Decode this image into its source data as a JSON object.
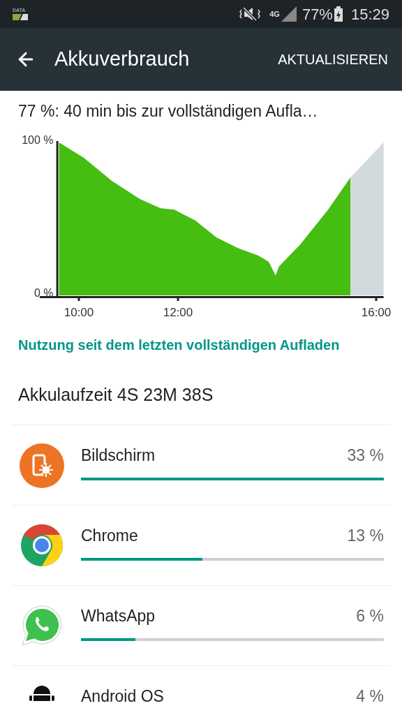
{
  "status_bar": {
    "data_label": "DATA",
    "network": "4G",
    "battery": "77%",
    "time": "15:29"
  },
  "app_bar": {
    "title": "Akkuverbrauch",
    "action": "AKTUALISIEREN"
  },
  "summary": "77 %: 40 min bis zur vollständigen Aufla…",
  "chart_data": {
    "type": "area",
    "xlim": [
      9.21,
      16.15
    ],
    "ylim": [
      0,
      100
    ],
    "x": [
      9.6,
      10.1,
      10.66,
      11.23,
      11.65,
      11.93,
      12.35,
      12.77,
      13.2,
      13.62,
      13.83,
      13.97,
      14.04,
      14.46,
      15.03,
      15.48,
      16.15
    ],
    "series": [
      {
        "color": "#45bd11",
        "values": [
          100,
          90,
          75,
          63,
          57,
          56,
          49,
          38,
          31,
          26,
          22,
          13,
          19,
          33,
          56,
          77,
          null
        ]
      },
      {
        "color": "#d3dadd",
        "values": [
          null,
          null,
          null,
          null,
          null,
          null,
          null,
          null,
          null,
          null,
          null,
          null,
          null,
          null,
          null,
          77,
          100
        ]
      }
    ],
    "xticks": [
      {
        "value": 10,
        "label": "10:00"
      },
      {
        "value": 12,
        "label": "12:00"
      },
      {
        "value": 16,
        "label": "16:00"
      }
    ],
    "yticks": [
      {
        "value": 0,
        "label": "0 %"
      },
      {
        "value": 100,
        "label": "100 %"
      }
    ]
  },
  "section_heading": "Nutzung seit dem letzten vollständigen Aufladen",
  "runtime": "Akkulaufzeit 4S 23M 38S",
  "apps": [
    {
      "kind": "display",
      "name": "Bildschirm",
      "percent": "33 %",
      "level": 1.0
    },
    {
      "kind": "chrome",
      "name": "Chrome",
      "percent": "13 %",
      "level": 0.4
    },
    {
      "kind": "whatsapp",
      "name": "WhatsApp",
      "percent": "6 %",
      "level": 0.18
    },
    {
      "kind": "android",
      "name": "Android OS",
      "percent": "4 %"
    }
  ]
}
